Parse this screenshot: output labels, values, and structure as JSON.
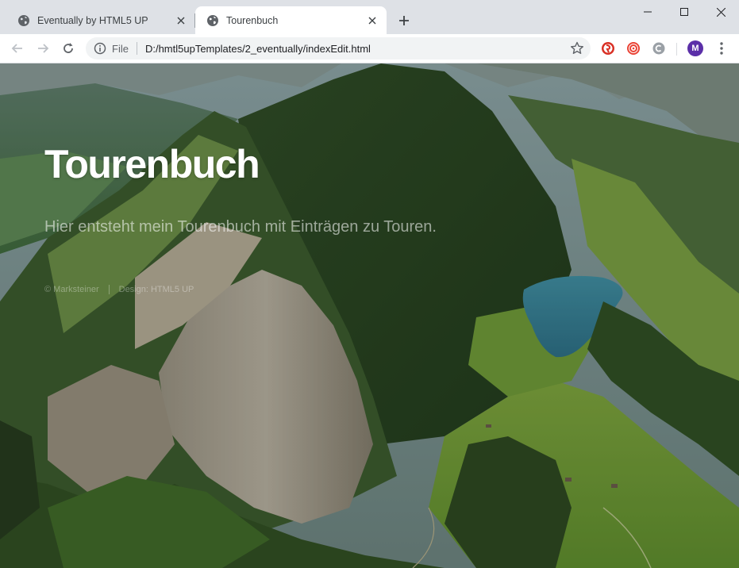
{
  "browser": {
    "tabs": [
      {
        "title": "Eventually by HTML5 UP",
        "active": false,
        "icon": "globe-icon"
      },
      {
        "title": "Tourenbuch",
        "active": true,
        "icon": "globe-icon"
      }
    ],
    "address": {
      "scheme_label": "File",
      "url": "D:/hmtl5upTemplates/2_eventually/indexEdit.html"
    },
    "profile_initial": "M",
    "colors": {
      "tabstrip": "#dee1e6",
      "avatar": "#5b2fa8",
      "ext_red": "#d93025"
    }
  },
  "page": {
    "title": "Tourenbuch",
    "subtitle": "Hier entsteht mein Tourenbuch mit Einträgen zu Touren.",
    "footer": {
      "copyright": "© Marksteiner",
      "credit": "Design: HTML5 UP"
    },
    "background": "alpine-valley-with-lake"
  }
}
